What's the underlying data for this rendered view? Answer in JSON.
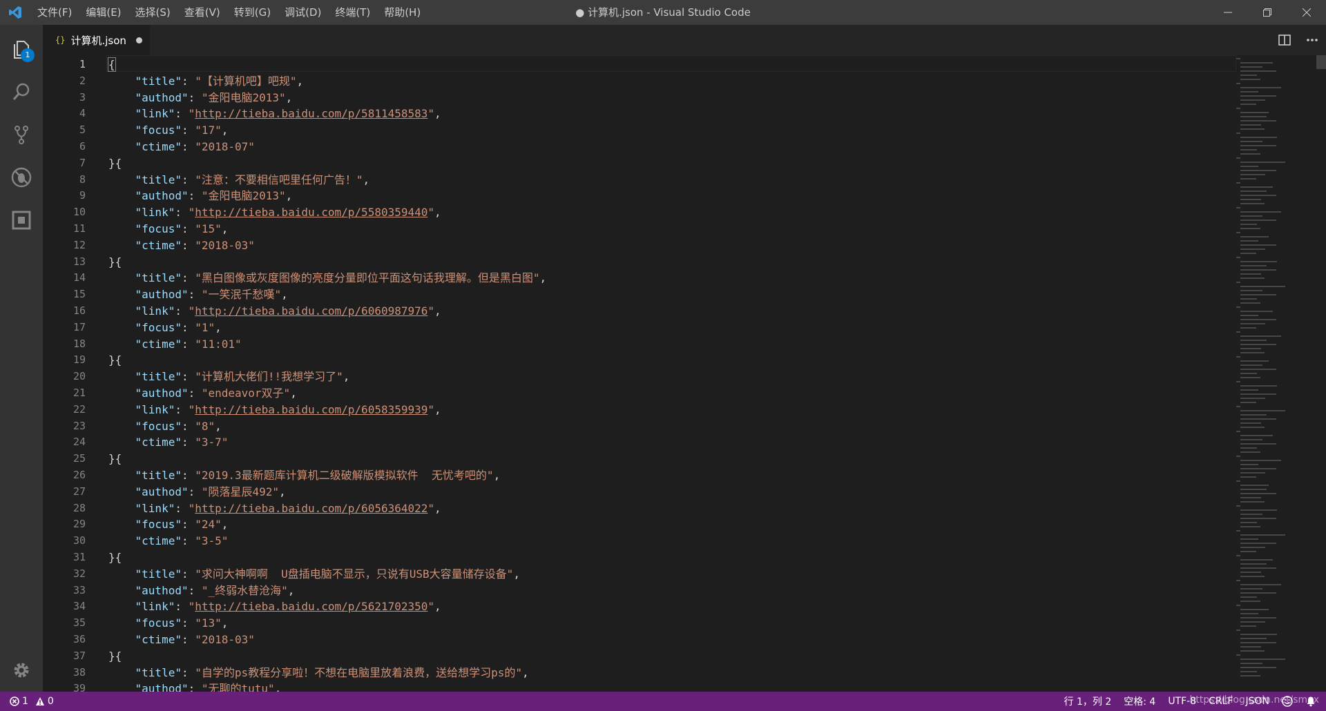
{
  "window": {
    "title": "● 计算机.json - Visual Studio Code"
  },
  "menu": [
    {
      "label": "文件(F)",
      "name": "menu-file"
    },
    {
      "label": "编辑(E)",
      "name": "menu-edit"
    },
    {
      "label": "选择(S)",
      "name": "menu-selection"
    },
    {
      "label": "查看(V)",
      "name": "menu-view"
    },
    {
      "label": "转到(G)",
      "name": "menu-go"
    },
    {
      "label": "调试(D)",
      "name": "menu-debug"
    },
    {
      "label": "终端(T)",
      "name": "menu-terminal"
    },
    {
      "label": "帮助(H)",
      "name": "menu-help"
    }
  ],
  "activity": {
    "explorer_badge": "1"
  },
  "tab": {
    "icon_text": "{}",
    "label": "计算机.json"
  },
  "editor": {
    "current_line": 1,
    "lines": [
      [
        [
          "p",
          "{"
        ]
      ],
      [
        [
          "p",
          "    "
        ],
        [
          "k",
          "\"title\""
        ],
        [
          "p",
          ": "
        ],
        [
          "s",
          "\"【计算机吧】吧规\""
        ],
        [
          "p",
          ","
        ]
      ],
      [
        [
          "p",
          "    "
        ],
        [
          "k",
          "\"authod\""
        ],
        [
          "p",
          ": "
        ],
        [
          "s",
          "\"金阳电脑2013\""
        ],
        [
          "p",
          ","
        ]
      ],
      [
        [
          "p",
          "    "
        ],
        [
          "k",
          "\"link\""
        ],
        [
          "p",
          ": "
        ],
        [
          "s",
          "\""
        ],
        [
          "l",
          "http://tieba.baidu.com/p/5811458583"
        ],
        [
          "s",
          "\""
        ],
        [
          "p",
          ","
        ]
      ],
      [
        [
          "p",
          "    "
        ],
        [
          "k",
          "\"focus\""
        ],
        [
          "p",
          ": "
        ],
        [
          "s",
          "\"17\""
        ],
        [
          "p",
          ","
        ]
      ],
      [
        [
          "p",
          "    "
        ],
        [
          "k",
          "\"ctime\""
        ],
        [
          "p",
          ": "
        ],
        [
          "s",
          "\"2018-07\""
        ]
      ],
      [
        [
          "p",
          "}{"
        ]
      ],
      [
        [
          "p",
          "    "
        ],
        [
          "k",
          "\"title\""
        ],
        [
          "p",
          ": "
        ],
        [
          "s",
          "\"注意：不要相信吧里任何广告！\""
        ],
        [
          "p",
          ","
        ]
      ],
      [
        [
          "p",
          "    "
        ],
        [
          "k",
          "\"authod\""
        ],
        [
          "p",
          ": "
        ],
        [
          "s",
          "\"金阳电脑2013\""
        ],
        [
          "p",
          ","
        ]
      ],
      [
        [
          "p",
          "    "
        ],
        [
          "k",
          "\"link\""
        ],
        [
          "p",
          ": "
        ],
        [
          "s",
          "\""
        ],
        [
          "l",
          "http://tieba.baidu.com/p/5580359440"
        ],
        [
          "s",
          "\""
        ],
        [
          "p",
          ","
        ]
      ],
      [
        [
          "p",
          "    "
        ],
        [
          "k",
          "\"focus\""
        ],
        [
          "p",
          ": "
        ],
        [
          "s",
          "\"15\""
        ],
        [
          "p",
          ","
        ]
      ],
      [
        [
          "p",
          "    "
        ],
        [
          "k",
          "\"ctime\""
        ],
        [
          "p",
          ": "
        ],
        [
          "s",
          "\"2018-03\""
        ]
      ],
      [
        [
          "p",
          "}{"
        ]
      ],
      [
        [
          "p",
          "    "
        ],
        [
          "k",
          "\"title\""
        ],
        [
          "p",
          ": "
        ],
        [
          "s",
          "\"黑白图像或灰度图像的亮度分量即位平面这句话我理解。但是黑白图\""
        ],
        [
          "p",
          ","
        ]
      ],
      [
        [
          "p",
          "    "
        ],
        [
          "k",
          "\"authod\""
        ],
        [
          "p",
          ": "
        ],
        [
          "s",
          "\"一笑泯千愁嘆\""
        ],
        [
          "p",
          ","
        ]
      ],
      [
        [
          "p",
          "    "
        ],
        [
          "k",
          "\"link\""
        ],
        [
          "p",
          ": "
        ],
        [
          "s",
          "\""
        ],
        [
          "l",
          "http://tieba.baidu.com/p/6060987976"
        ],
        [
          "s",
          "\""
        ],
        [
          "p",
          ","
        ]
      ],
      [
        [
          "p",
          "    "
        ],
        [
          "k",
          "\"focus\""
        ],
        [
          "p",
          ": "
        ],
        [
          "s",
          "\"1\""
        ],
        [
          "p",
          ","
        ]
      ],
      [
        [
          "p",
          "    "
        ],
        [
          "k",
          "\"ctime\""
        ],
        [
          "p",
          ": "
        ],
        [
          "s",
          "\"11:01\""
        ]
      ],
      [
        [
          "p",
          "}{"
        ]
      ],
      [
        [
          "p",
          "    "
        ],
        [
          "k",
          "\"title\""
        ],
        [
          "p",
          ": "
        ],
        [
          "s",
          "\"计算机大佬们!!我想学习了\""
        ],
        [
          "p",
          ","
        ]
      ],
      [
        [
          "p",
          "    "
        ],
        [
          "k",
          "\"authod\""
        ],
        [
          "p",
          ": "
        ],
        [
          "s",
          "\"endeavor双子\""
        ],
        [
          "p",
          ","
        ]
      ],
      [
        [
          "p",
          "    "
        ],
        [
          "k",
          "\"link\""
        ],
        [
          "p",
          ": "
        ],
        [
          "s",
          "\""
        ],
        [
          "l",
          "http://tieba.baidu.com/p/6058359939"
        ],
        [
          "s",
          "\""
        ],
        [
          "p",
          ","
        ]
      ],
      [
        [
          "p",
          "    "
        ],
        [
          "k",
          "\"focus\""
        ],
        [
          "p",
          ": "
        ],
        [
          "s",
          "\"8\""
        ],
        [
          "p",
          ","
        ]
      ],
      [
        [
          "p",
          "    "
        ],
        [
          "k",
          "\"ctime\""
        ],
        [
          "p",
          ": "
        ],
        [
          "s",
          "\"3-7\""
        ]
      ],
      [
        [
          "p",
          "}{"
        ]
      ],
      [
        [
          "p",
          "    "
        ],
        [
          "k",
          "\"title\""
        ],
        [
          "p",
          ": "
        ],
        [
          "s",
          "\"2019.3最新题库计算机二级破解版模拟软件  无忧考吧的\""
        ],
        [
          "p",
          ","
        ]
      ],
      [
        [
          "p",
          "    "
        ],
        [
          "k",
          "\"authod\""
        ],
        [
          "p",
          ": "
        ],
        [
          "s",
          "\"陨落星辰492\""
        ],
        [
          "p",
          ","
        ]
      ],
      [
        [
          "p",
          "    "
        ],
        [
          "k",
          "\"link\""
        ],
        [
          "p",
          ": "
        ],
        [
          "s",
          "\""
        ],
        [
          "l",
          "http://tieba.baidu.com/p/6056364022"
        ],
        [
          "s",
          "\""
        ],
        [
          "p",
          ","
        ]
      ],
      [
        [
          "p",
          "    "
        ],
        [
          "k",
          "\"focus\""
        ],
        [
          "p",
          ": "
        ],
        [
          "s",
          "\"24\""
        ],
        [
          "p",
          ","
        ]
      ],
      [
        [
          "p",
          "    "
        ],
        [
          "k",
          "\"ctime\""
        ],
        [
          "p",
          ": "
        ],
        [
          "s",
          "\"3-5\""
        ]
      ],
      [
        [
          "p",
          "}{"
        ]
      ],
      [
        [
          "p",
          "    "
        ],
        [
          "k",
          "\"title\""
        ],
        [
          "p",
          ": "
        ],
        [
          "s",
          "\"求问大神啊啊  U盘插电脑不显示，只说有USB大容量储存设备\""
        ],
        [
          "p",
          ","
        ]
      ],
      [
        [
          "p",
          "    "
        ],
        [
          "k",
          "\"authod\""
        ],
        [
          "p",
          ": "
        ],
        [
          "s",
          "\"_终弱水替沧海\""
        ],
        [
          "p",
          ","
        ]
      ],
      [
        [
          "p",
          "    "
        ],
        [
          "k",
          "\"link\""
        ],
        [
          "p",
          ": "
        ],
        [
          "s",
          "\""
        ],
        [
          "l",
          "http://tieba.baidu.com/p/5621702350"
        ],
        [
          "s",
          "\""
        ],
        [
          "p",
          ","
        ]
      ],
      [
        [
          "p",
          "    "
        ],
        [
          "k",
          "\"focus\""
        ],
        [
          "p",
          ": "
        ],
        [
          "s",
          "\"13\""
        ],
        [
          "p",
          ","
        ]
      ],
      [
        [
          "p",
          "    "
        ],
        [
          "k",
          "\"ctime\""
        ],
        [
          "p",
          ": "
        ],
        [
          "s",
          "\"2018-03\""
        ]
      ],
      [
        [
          "p",
          "}{"
        ]
      ],
      [
        [
          "p",
          "    "
        ],
        [
          "k",
          "\"title\""
        ],
        [
          "p",
          ": "
        ],
        [
          "s",
          "\"自学的ps教程分享啦！不想在电脑里放着浪费，送给想学习ps的\""
        ],
        [
          "p",
          ","
        ]
      ],
      [
        [
          "p",
          "    "
        ],
        [
          "k",
          "\"authod\""
        ],
        [
          "p",
          ": "
        ],
        [
          "s",
          "\"无聊的tutu\""
        ],
        [
          "p",
          ","
        ]
      ]
    ]
  },
  "status": {
    "errors": "1",
    "warnings": "0",
    "position": "行 1，列 2",
    "spaces": "空格: 4",
    "encoding": "UTF-8",
    "eol": "CRLF",
    "language": "JSON",
    "watermark": "https://blog.csdn.net/smax"
  },
  "colors": {
    "status_bar": "#68217a",
    "key": "#9cdcfe",
    "string": "#ce9178",
    "line_number": "#858585"
  }
}
